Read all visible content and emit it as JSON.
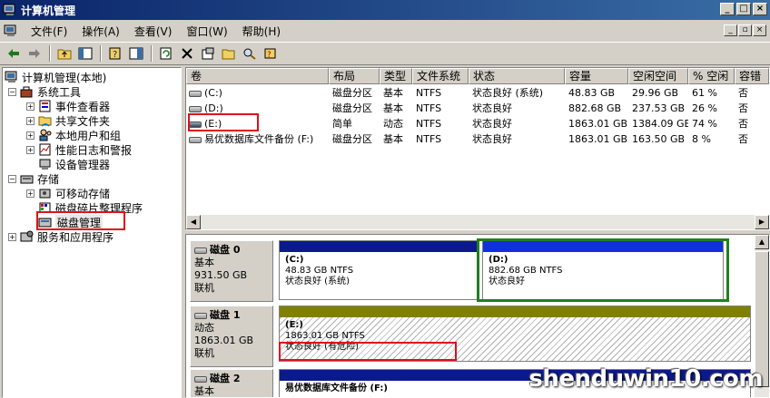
{
  "window": {
    "title": "计算机管理",
    "min": "_",
    "max": "□",
    "close": "×"
  },
  "menu": {
    "items": [
      "文件(F)",
      "操作(A)",
      "查看(V)",
      "窗口(W)",
      "帮助(H)"
    ],
    "mdi_min": "_",
    "mdi_restore": "▫",
    "mdi_close": "×"
  },
  "tree": {
    "root": "计算机管理(本地)",
    "system_tools": "系统工具",
    "event_viewer": "事件查看器",
    "shared_folders": "共享文件夹",
    "local_users": "本地用户和组",
    "perf_logs": "性能日志和警报",
    "device_manager": "设备管理器",
    "storage": "存储",
    "removable": "可移动存储",
    "defrag": "磁盘碎片整理程序",
    "disk_mgmt": "磁盘管理",
    "services": "服务和应用程序"
  },
  "vollist": {
    "headers": [
      "卷",
      "布局",
      "类型",
      "文件系统",
      "状态",
      "容量",
      "空闲空间",
      "% 空闲",
      "容错"
    ],
    "rows": [
      [
        "(C:)",
        "磁盘分区",
        "基本",
        "NTFS",
        "状态良好 (系统)",
        "48.83 GB",
        "29.96 GB",
        "61 %",
        "否"
      ],
      [
        "(D:)",
        "磁盘分区",
        "基本",
        "NTFS",
        "状态良好",
        "882.68 GB",
        "237.53 GB",
        "26 %",
        "否"
      ],
      [
        "(E:)",
        "简单",
        "动态",
        "NTFS",
        "状态良好",
        "1863.01 GB",
        "1384.09 GB",
        "74 %",
        "否"
      ],
      [
        "易优数据库文件备份 (F:)",
        "磁盘分区",
        "基本",
        "NTFS",
        "状态良好",
        "1863.01 GB",
        "163.50 GB",
        "8 %",
        "否"
      ]
    ]
  },
  "disks": {
    "disk0": {
      "name": "磁盘 0",
      "type": "基本",
      "size": "931.50 GB",
      "status": "联机"
    },
    "disk1": {
      "name": "磁盘 1",
      "type": "动态",
      "size": "1863.01 GB",
      "status": "联机"
    },
    "disk2": {
      "name": "磁盘 2",
      "type": "基本"
    }
  },
  "partitions": {
    "c": {
      "name": "(C:)",
      "size": "48.83 GB NTFS",
      "status": "状态良好 (系统)"
    },
    "d": {
      "name": "(D:)",
      "size": "882.68 GB NTFS",
      "status": "状态良好"
    },
    "e": {
      "name": "(E:)",
      "size": "1863.01 GB NTFS",
      "status": "状态良好 (有危险)"
    },
    "f": {
      "name": "易优数据库文件备份 (F:)"
    }
  },
  "colors": {
    "primary_bar": "#0a1a8c",
    "simple_bar": "#808000",
    "highlight": "#e0101a",
    "selected_outline": "#208020"
  },
  "watermark": "shenduwin10.com"
}
